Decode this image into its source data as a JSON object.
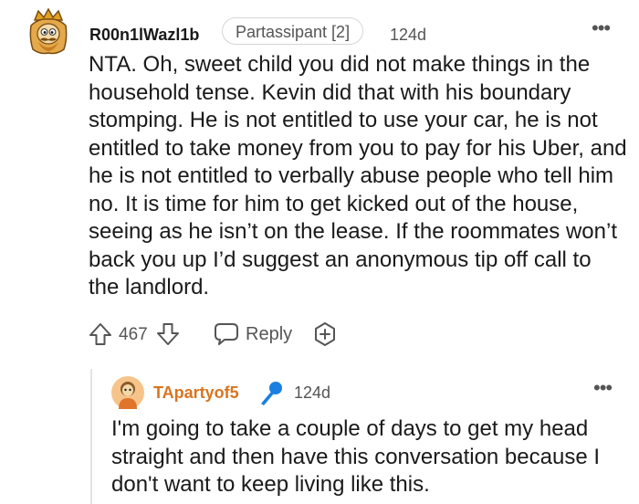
{
  "comment": {
    "username": "R00n1lWazl1b",
    "flair": "Partassipant [2]",
    "timestamp": "124d",
    "more_label": "•••",
    "body": "NTA. Oh, sweet child you did not make things in the household tense. Kevin did that with his boundary stomping. He is not entitled to use your car, he is not entitled to take money from you to pay for his Uber, and he is not entitled to verbally abuse people who tell him no. It is time for him to get kicked out of the house, seeing as he isn’t on the lease. If the roommates won’t back you up I’d suggest an anonymous tip off call to the landlord.",
    "score": "467",
    "reply_label": "Reply",
    "icons": {
      "upvote": "upvote-icon",
      "downvote": "downvote-icon",
      "reply": "speech-bubble-icon",
      "award": "award-icon"
    }
  },
  "reply": {
    "username": "TApartyof5",
    "timestamp": "124d",
    "more_label": "•••",
    "body": "I'm going to take a couple of days to get my head straight and then have this conversation because I don't want to keep living like this.",
    "icons": {
      "op_badge": "microphone-icon"
    }
  },
  "colors": {
    "text": "#1a1a1b",
    "muted": "#555555",
    "op_username": "#d9741f",
    "mic_blue": "#1a7fe0",
    "thread_line": "#e3e3e3"
  }
}
